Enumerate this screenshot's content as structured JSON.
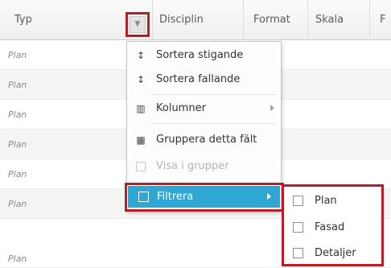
{
  "grid": {
    "columns": [
      {
        "label": "Typ"
      },
      {
        "label": "Disciplin"
      },
      {
        "label": "Format"
      },
      {
        "label": "Skala"
      },
      {
        "label": "F"
      }
    ],
    "rows": [
      {
        "typ": "Plan"
      },
      {
        "typ": "Plan"
      },
      {
        "typ": "Plan"
      },
      {
        "typ": "Plan"
      },
      {
        "typ": "Plan"
      },
      {
        "typ": "Plan"
      },
      {
        "typ": "Plan"
      }
    ]
  },
  "column_menu": {
    "items": [
      {
        "label": "Sortera stigande",
        "icon": "sort-ascending-icon"
      },
      {
        "label": "Sortera fallande",
        "icon": "sort-descending-icon"
      },
      {
        "label": "Kolumner",
        "icon": "columns-icon"
      },
      {
        "label": "Gruppera detta fält",
        "icon": "group-by-icon"
      },
      {
        "label": "Visa i grupper",
        "icon": "checkbox-icon"
      },
      {
        "label": "Filtrera",
        "icon": "checkbox-icon"
      }
    ]
  },
  "filter_submenu": {
    "options": [
      {
        "label": "Plan",
        "checked": false
      },
      {
        "label": "Fasad",
        "checked": false
      },
      {
        "label": "Detaljer",
        "checked": false
      }
    ]
  },
  "colors": {
    "highlight": "#2fa7d4",
    "annotation_border": "#b81e27"
  }
}
